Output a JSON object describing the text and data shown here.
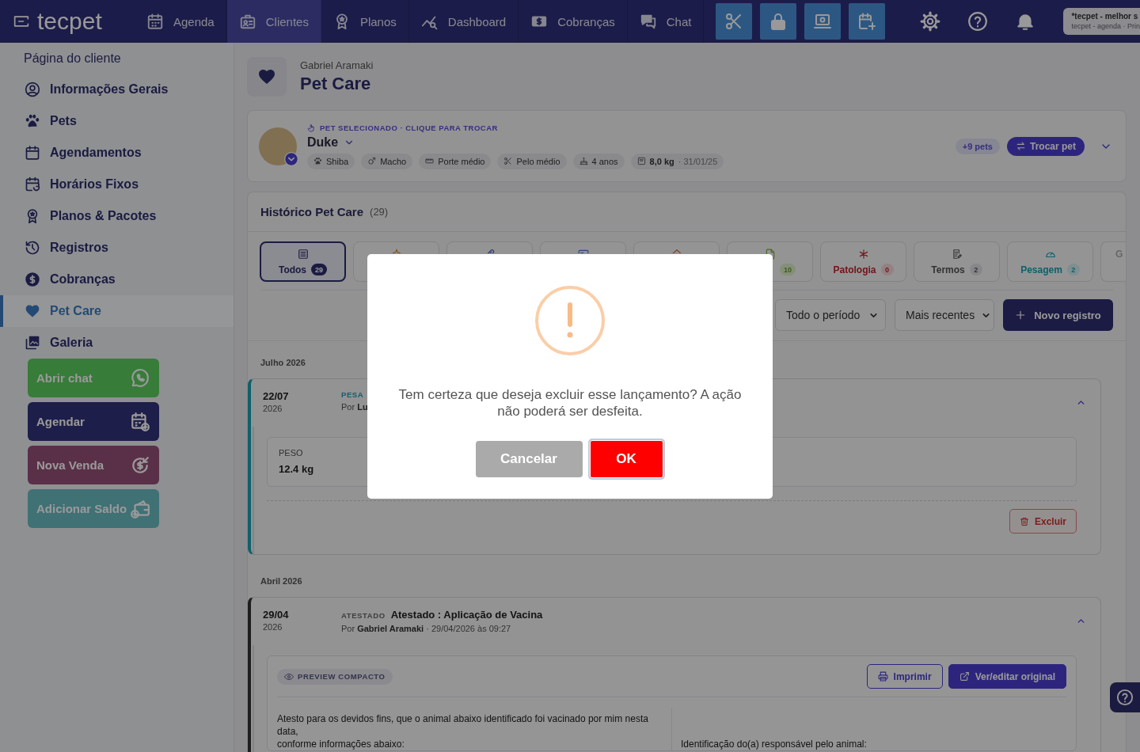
{
  "top_nav": {
    "logo": "tecpet",
    "items": [
      {
        "label": "Agenda",
        "selected": false
      },
      {
        "label": "Clientes",
        "selected": true
      },
      {
        "label": "Planos",
        "selected": false
      },
      {
        "label": "Dashboard",
        "selected": false
      },
      {
        "label": "Cobranças",
        "selected": false
      },
      {
        "label": "Chat",
        "selected": false
      }
    ],
    "account": {
      "name": "*tecpet - melhor s",
      "detail": "tecpet - agenda · Prin"
    }
  },
  "sidebar": {
    "title": "Página do cliente",
    "items": [
      {
        "label": "Informações Gerais",
        "selected": false
      },
      {
        "label": "Pets",
        "selected": false
      },
      {
        "label": "Agendamentos",
        "selected": false
      },
      {
        "label": "Horários Fixos",
        "selected": false
      },
      {
        "label": "Planos & Pacotes",
        "selected": false
      },
      {
        "label": "Registros",
        "selected": false
      },
      {
        "label": "Cobranças",
        "selected": false
      },
      {
        "label": "Pet Care",
        "selected": true
      },
      {
        "label": "Galeria",
        "selected": false
      }
    ],
    "actions": [
      {
        "label": "Abrir chat"
      },
      {
        "label": "Agendar"
      },
      {
        "label": "Nova Venda"
      },
      {
        "label": "Adicionar Saldo"
      }
    ]
  },
  "header": {
    "client": "Gabriel Aramaki",
    "title": "Pet Care"
  },
  "pet": {
    "caption": "PET SELECIONADO · CLIQUE PARA TROCAR",
    "name": "Duke",
    "traits": [
      {
        "label": "Shiba"
      },
      {
        "label": "Macho"
      },
      {
        "label": "Porte médio"
      },
      {
        "label": "Pelo médio"
      },
      {
        "label": "4 anos"
      },
      {
        "label": "8,0 kg",
        "note": "· 31/01/25"
      }
    ],
    "more_pets": "+9 pets",
    "switch_button": "Trocar pet"
  },
  "history": {
    "title": "Histórico Pet Care",
    "count": "(29)",
    "tabs": [
      {
        "label": "Todos",
        "count": "29",
        "selected": true
      },
      {
        "selected": false
      },
      {
        "selected": false
      },
      {
        "selected": false
      },
      {
        "selected": false
      },
      {
        "count": "10",
        "selected": false
      },
      {
        "label": "Patologia",
        "count": "0",
        "selected": false
      },
      {
        "label": "Termos",
        "count": "2",
        "selected": false
      },
      {
        "label": "Pesagem",
        "count": "2",
        "selected": false
      },
      {
        "label": "G",
        "selected": false
      }
    ],
    "filters": {
      "period": "Todo o período",
      "order": "Mais recentes"
    },
    "new_button": "Novo registro",
    "groups": [
      {
        "month": "Julho 2026",
        "entries": [
          {
            "kind": "weight",
            "date": "22/07",
            "year": "2026",
            "type": "PESA",
            "meta": "Por **Lu**",
            "expanded": true,
            "fields": [
              {
                "label": "PESO",
                "value": "12.4 kg"
              }
            ],
            "delete_button": "Excluir"
          }
        ]
      },
      {
        "month": "Abril 2026",
        "entries": [
          {
            "kind": "certificate",
            "date": "29/04",
            "year": "2026",
            "type": "ATESTADO",
            "title": "Atestado : Aplicação de Vacina",
            "meta": "Por **Gabriel Aramaki** · 29/04/2026 às 09:27",
            "expanded": true,
            "preview": {
              "badge": "PREVIEW COMPACTO",
              "print_button": "Imprimir",
              "edit_button": "Ver/editar original",
              "left_text": "Atesto para os devidos fins, que o animal abaixo identificado foi vacinado por mim nesta data,\nconforme informações abaixo:",
              "right_text": "Identificação do(a) responsável pelo animal:"
            }
          }
        ]
      }
    ]
  },
  "modal": {
    "message": "Tem certeza que deseja excluir esse lançamento? A ação não poderá ser desfeita.",
    "cancel_button": "Cancelar",
    "confirm_button": "OK"
  }
}
